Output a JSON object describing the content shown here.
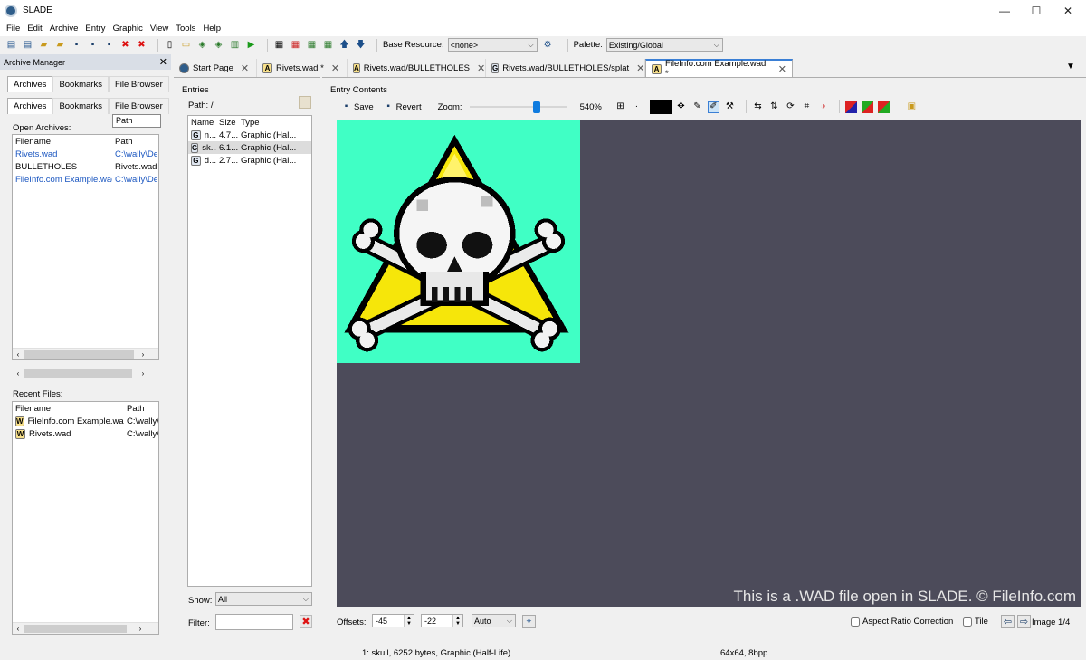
{
  "window": {
    "title": "SLADE",
    "minimize": "—",
    "maximize": "☐",
    "close": "✕"
  },
  "menu": [
    "File",
    "Edit",
    "Archive",
    "Entry",
    "Graphic",
    "View",
    "Tools",
    "Help"
  ],
  "toolbar": {
    "base_resource_label": "Base Resource:",
    "base_resource_value": "<none>",
    "palette_label": "Palette:",
    "palette_value": "Existing/Global"
  },
  "archive_manager": {
    "title": "Archive Manager",
    "close": "✕",
    "outer_tabs": [
      "Archives",
      "Bookmarks",
      "File Browser"
    ],
    "inner_tabs": [
      "Archives",
      "Bookmarks",
      "File Browser"
    ],
    "path_tooltip": "Path",
    "open_archives_label": "Open Archives:",
    "columns": {
      "filename": "Filename",
      "path": "Path"
    },
    "open_archives": [
      {
        "filename": "Rivets.wad",
        "path": "C:\\wally\\De",
        "link": true
      },
      {
        "filename": "BULLETHOLES",
        "path": "Rivets.wad",
        "link": false
      },
      {
        "filename": "FileInfo.com Example.wad",
        "path": "C:\\wally\\De",
        "link": true
      }
    ],
    "recent_label": "Recent Files:",
    "recent_files": [
      {
        "filename": "FileInfo.com Example.wad",
        "path": "C:\\wally\\"
      },
      {
        "filename": "Rivets.wad",
        "path": "C:\\wally\\"
      }
    ]
  },
  "doc_tabs": [
    {
      "label": "Start Page",
      "close": "✕"
    },
    {
      "label": "Rivets.wad *",
      "close": "✕"
    },
    {
      "label": "Rivets.wad/BULLETHOLES",
      "close": "✕"
    },
    {
      "label": "Rivets.wad/BULLETHOLES/splat",
      "close": "✕"
    },
    {
      "label": "FileInfo.com Example.wad *",
      "close": "✕"
    }
  ],
  "entries": {
    "title": "Entries",
    "path": "Path: /",
    "columns": {
      "name": "Name",
      "size": "Size",
      "type": "Type"
    },
    "rows": [
      {
        "name": "n...",
        "size": "4.7...",
        "type": "Graphic (Hal..."
      },
      {
        "name": "sk...",
        "size": "6.1...",
        "type": "Graphic (Hal..."
      },
      {
        "name": "d...",
        "size": "2.7...",
        "type": "Graphic (Hal..."
      }
    ],
    "show_label": "Show:",
    "show_value": "All",
    "filter_label": "Filter:",
    "filter_value": ""
  },
  "entry_contents": {
    "title": "Entry Contents",
    "save": "Save",
    "revert": "Revert",
    "zoom_label": "Zoom:",
    "zoom_value": "540%",
    "zoom_level": 0.7,
    "watermark": "This is a .WAD file open in SLADE. © FileInfo.com",
    "offsets_label": "Offsets:",
    "offset_x": "-45",
    "offset_y": "-22",
    "offset_mode": "Auto",
    "aspect_label": "Aspect Ratio Correction",
    "tile_label": "Tile",
    "image_label": "Image 1/4"
  },
  "colors": {
    "canvas_bg": "#4c4b5a",
    "image_bg": "#40ffc5",
    "triangle": "#f6e60a",
    "accent": "#3a7fd5"
  },
  "status": {
    "left": "1: skull, 6252 bytes, Graphic (Half-Life)",
    "right": "64x64, 8bpp"
  }
}
